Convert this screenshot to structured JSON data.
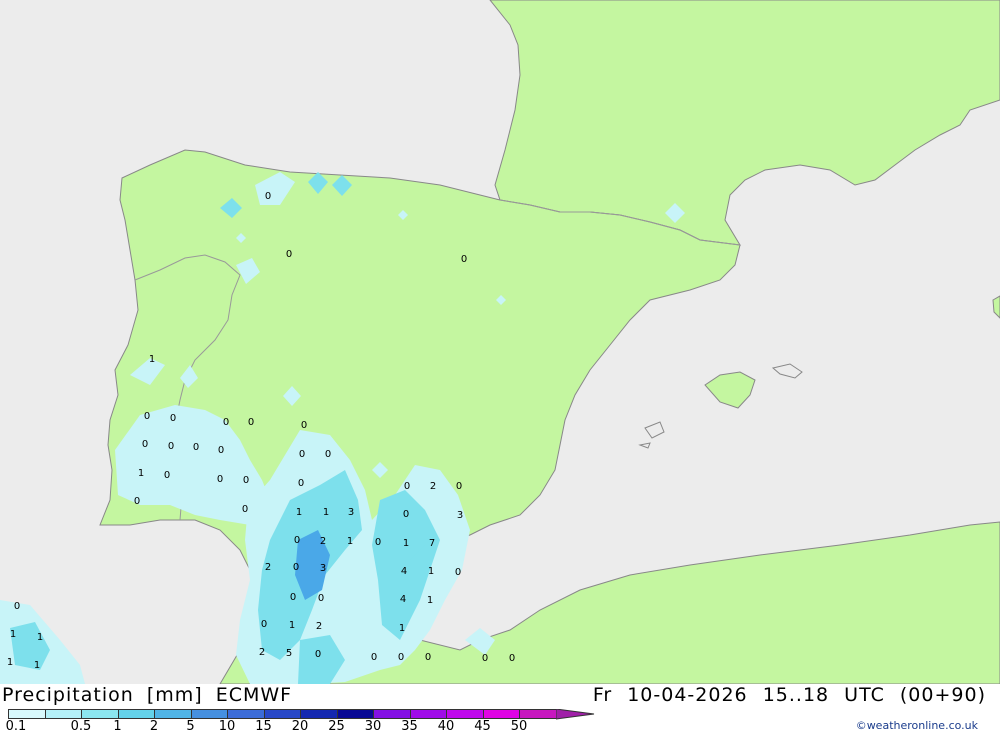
{
  "map": {
    "region": "Iberian Peninsula",
    "colors": {
      "sea": "#ececec",
      "land": "#c4f6a0",
      "border": "#999999",
      "coast": "#888888",
      "precip_light": "#c8f4f8",
      "precip_mid": "#7de0ec",
      "precip_blue": "#4aa8e8"
    },
    "values": [
      "0",
      "0",
      "0",
      "0",
      "1",
      "0",
      "0",
      "0",
      "0",
      "0",
      "0",
      "0",
      "0",
      "0",
      "0",
      "1",
      "0",
      "0",
      "0",
      "0",
      "0",
      "0",
      "2",
      "0",
      "0",
      "1",
      "1",
      "3",
      "0",
      "3",
      "0",
      "2",
      "1",
      "0",
      "1",
      "7",
      "2",
      "0",
      "3",
      "4",
      "1",
      "0",
      "0",
      "0",
      "4",
      "1",
      "0",
      "0",
      "1",
      "2",
      "1",
      "2",
      "5",
      "0",
      "0",
      "0",
      "0",
      "0",
      "0",
      "1",
      "1",
      "1",
      "1"
    ]
  },
  "footer": {
    "title_parts": [
      "Precipitation",
      "[mm]",
      "ECMWF"
    ],
    "datetime_parts": [
      "Fr",
      "10-04-2026",
      "15..18",
      "UTC",
      "(00+90)"
    ],
    "credit": "©weatheronline.co.uk"
  },
  "legend": {
    "colors": [
      "#d8f8fc",
      "#b4f0f8",
      "#8ce6f0",
      "#64d2ea",
      "#50b4e6",
      "#4690e0",
      "#3c6cd8",
      "#2848c8",
      "#1428b0",
      "#080894",
      "#8410e4",
      "#a00ce8",
      "#c008ec",
      "#e004e4",
      "#c818c0",
      "#a020a8"
    ],
    "labels": [
      "0.1",
      "0.5",
      "1",
      "2",
      "5",
      "10",
      "15",
      "20",
      "25",
      "30",
      "35",
      "40",
      "45",
      "50"
    ]
  }
}
